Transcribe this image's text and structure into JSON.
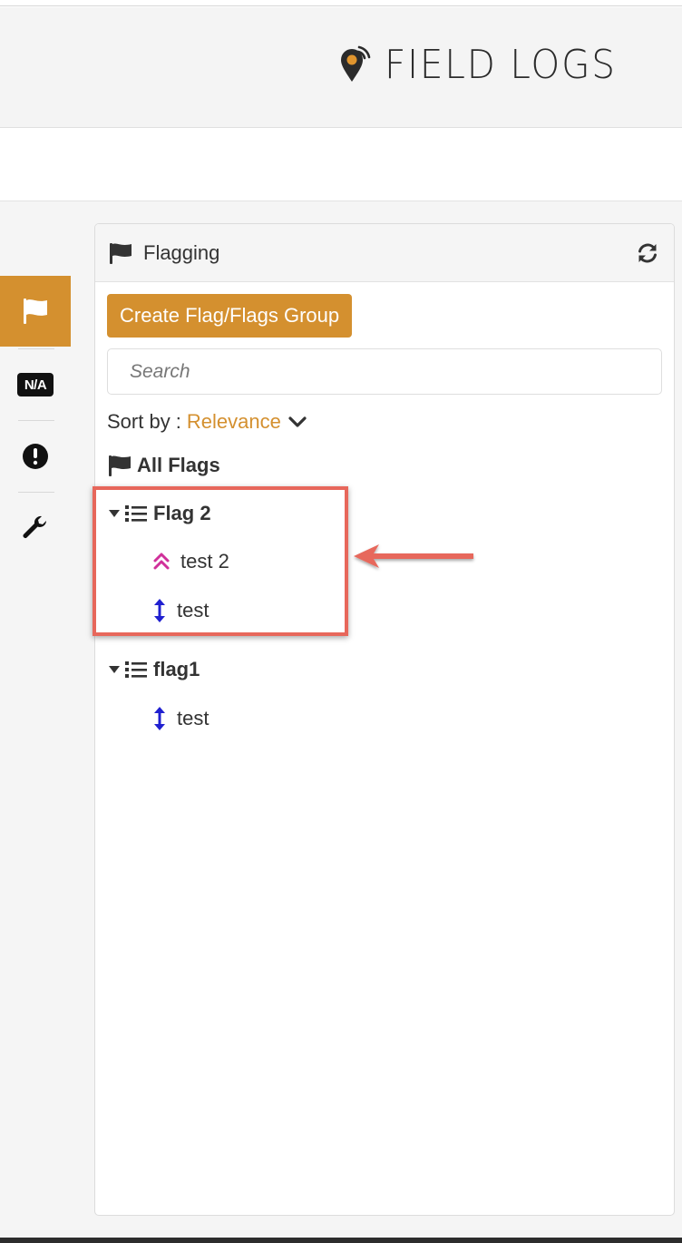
{
  "app": {
    "logo_text": "FIELD LOGS"
  },
  "sidebar": {
    "items": [
      {
        "name": "flag",
        "icon": "flag-icon",
        "active": true
      },
      {
        "name": "na",
        "icon": "na-badge-icon",
        "label": "N/A"
      },
      {
        "name": "alert",
        "icon": "exclamation-icon"
      },
      {
        "name": "tools",
        "icon": "wrench-icon"
      }
    ]
  },
  "panel": {
    "title": "Flagging",
    "create_button": "Create Flag/Flags Group",
    "search_placeholder": "Search",
    "sort_label": "Sort by :",
    "sort_value": "Relevance",
    "all_flags": "All Flags",
    "groups": [
      {
        "name": "Flag 2",
        "items": [
          {
            "label": "test 2",
            "icon": "double-chevron-up-icon",
            "color": "#d0309a"
          },
          {
            "label": "test",
            "icon": "vertical-arrows-icon",
            "color": "#2020d0"
          }
        ]
      },
      {
        "name": "flag1",
        "items": [
          {
            "label": "test",
            "icon": "vertical-arrows-icon",
            "color": "#2020d0"
          }
        ]
      }
    ]
  },
  "colors": {
    "accent": "#d4902f",
    "annotation": "#e7675b",
    "priority_high": "#d0309a",
    "priority_normal": "#2020d0"
  }
}
